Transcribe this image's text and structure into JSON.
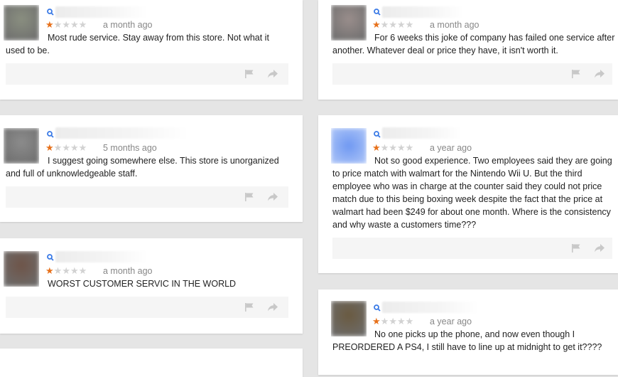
{
  "reviews": [
    {
      "time": "a month ago",
      "rating": 1,
      "text": "Most rude service. Stay away from this store. Not what it used to be.",
      "avatar_color": "#8a8f80"
    },
    {
      "time": "a month ago",
      "rating": 1,
      "text": "For 6 weeks this joke of company has failed one service after another. Whatever deal or price they have, it isn't worth it.",
      "avatar_color": "#9a8e8c"
    },
    {
      "time": "5 months ago",
      "rating": 1,
      "text": "I suggest going somewhere else. This store is unorganized and full of unknowledgeable staff.",
      "avatar_color": "#8c8c8c"
    },
    {
      "time": "a year ago",
      "rating": 1,
      "text": "Not so good experience. Two employees said they are going to price match with walmart for the Nintendo Wii U. But the third employee who was in charge at the counter said they could not price match due to this being boxing week despite the fact that the price at walmart had been $249 for about one month. Where is the consistency and why waste a customers time???",
      "avatar_color": "#7ea4f5"
    },
    {
      "time": "a month ago",
      "rating": 1,
      "text": "WORST CUSTOMER SERVIC IN THE WORLD",
      "avatar_color": "#6e5448"
    },
    {
      "time": "a year ago",
      "rating": 1,
      "text": "No one picks up the phone, and now even though I PREORDERED A PS4, I still have to line up at midnight to get it????",
      "avatar_color": "#6a5a40"
    }
  ],
  "icons": {
    "search": "search-icon",
    "flag": "flag-icon",
    "share": "share-icon",
    "star_on_color": "#e7711b",
    "star_off_color": "#d2d2d2"
  }
}
